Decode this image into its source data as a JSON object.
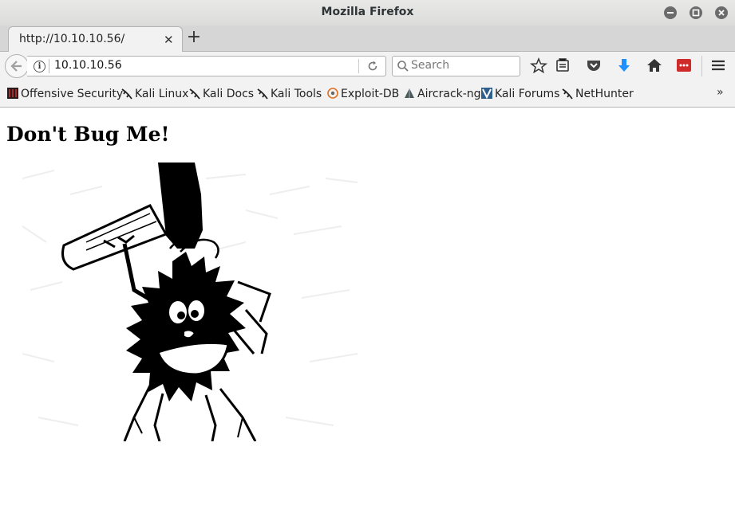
{
  "window": {
    "title": "Mozilla Firefox"
  },
  "tabs": [
    {
      "label": "http://10.10.10.56/"
    }
  ],
  "navbar": {
    "url": "10.10.10.56",
    "search_placeholder": "Search"
  },
  "bookmarks": [
    {
      "label": "Offensive Security"
    },
    {
      "label": "Kali Linux"
    },
    {
      "label": "Kali Docs"
    },
    {
      "label": "Kali Tools"
    },
    {
      "label": "Exploit-DB"
    },
    {
      "label": "Aircrack-ng"
    },
    {
      "label": "Kali Forums"
    },
    {
      "label": "NetHunter"
    }
  ],
  "bookmarks_overflow": "»",
  "page": {
    "heading": "Don't Bug Me!"
  },
  "colors": {
    "download_arrow": "#1e90ff",
    "pocket": "#444444",
    "addon_red": "#d02b2b"
  }
}
